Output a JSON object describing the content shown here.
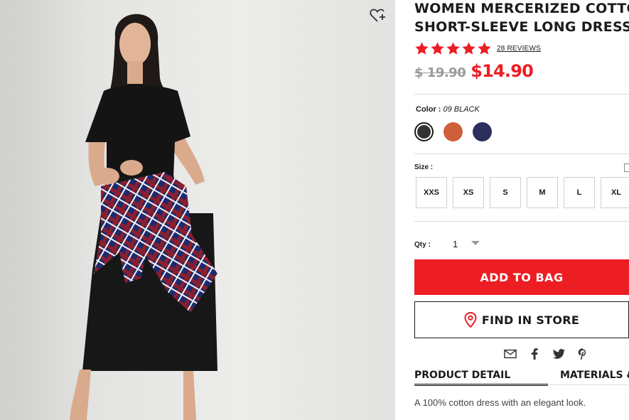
{
  "product": {
    "title_line1": "WOMEN MERCERIZED COTTON",
    "title_line2": "SHORT-SLEEVE LONG DRESS",
    "rating_stars": 5,
    "reviews_label": "28 REVIEWS",
    "old_price": "$ 19.90",
    "new_price": "$14.90",
    "description": "A 100% cotton dress with an elegant look."
  },
  "color": {
    "label": "Color :",
    "selected_name": "09 BLACK",
    "swatches": [
      {
        "name": "black",
        "hex": "#333333",
        "selected": true
      },
      {
        "name": "orange",
        "hex": "#cf5f3a",
        "selected": false
      },
      {
        "name": "navy",
        "hex": "#2a2f5c",
        "selected": false
      }
    ]
  },
  "size": {
    "label": "Size :",
    "options": [
      "XXS",
      "XS",
      "S",
      "M",
      "L",
      "XL"
    ]
  },
  "quantity": {
    "label": "Qty :",
    "value": "1"
  },
  "actions": {
    "add_to_bag": "ADD TO BAG",
    "find_in_store": "FIND IN STORE"
  },
  "share_icons": [
    "mail-icon",
    "facebook-icon",
    "twitter-icon",
    "pinterest-icon"
  ],
  "tabs": {
    "product_detail": "PRODUCT DETAIL",
    "materials": "MATERIALS &"
  },
  "colors": {
    "accent": "#ed1d24",
    "text": "#1b1b1b",
    "muted": "#9a9a9a"
  }
}
